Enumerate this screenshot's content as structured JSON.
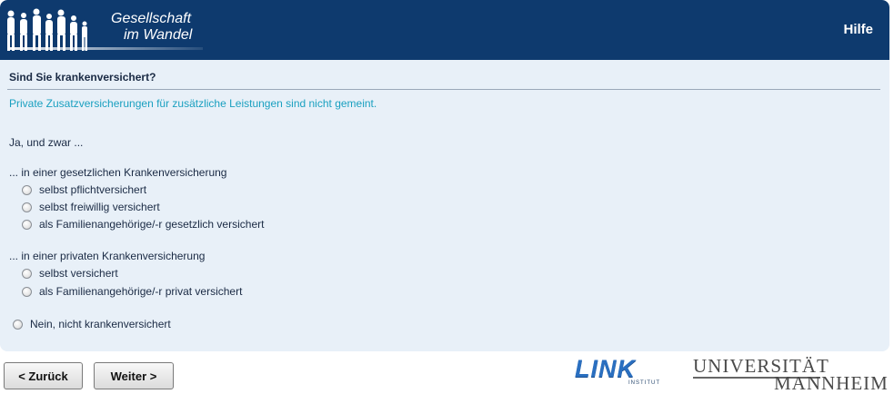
{
  "header": {
    "logo_line1": "Gesellschaft",
    "logo_line2": "im Wandel",
    "help_label": "Hilfe"
  },
  "question": {
    "title": "Sind Sie krankenversichert?",
    "hint": "Private Zusatzversicherungen für zusätzliche Leistungen sind nicht gemeint."
  },
  "answers": {
    "yes_intro": "Ja, und zwar ...",
    "group_public": {
      "label": "... in einer gesetzlichen Krankenversicherung",
      "options": [
        "selbst pflichtversichert",
        "selbst freiwillig versichert",
        "als Familienangehörige/-r gesetzlich versichert"
      ]
    },
    "group_private": {
      "label": "... in einer privaten Krankenversicherung",
      "options": [
        "selbst versichert",
        "als Familienangehörige/-r privat versichert"
      ]
    },
    "no_option": "Nein, nicht krankenversichert"
  },
  "navigation": {
    "back_label": "< Zurück",
    "next_label": "Weiter >"
  },
  "logos": {
    "link_main": "LINK",
    "link_sub": "INSTITUT",
    "uni_line1": "UNIVERSITÄT",
    "uni_line2": "MANNHEIM"
  },
  "colors": {
    "header_bg": "#0e3a6e",
    "content_bg": "#e8f0f8",
    "hint": "#1aa0c0"
  }
}
